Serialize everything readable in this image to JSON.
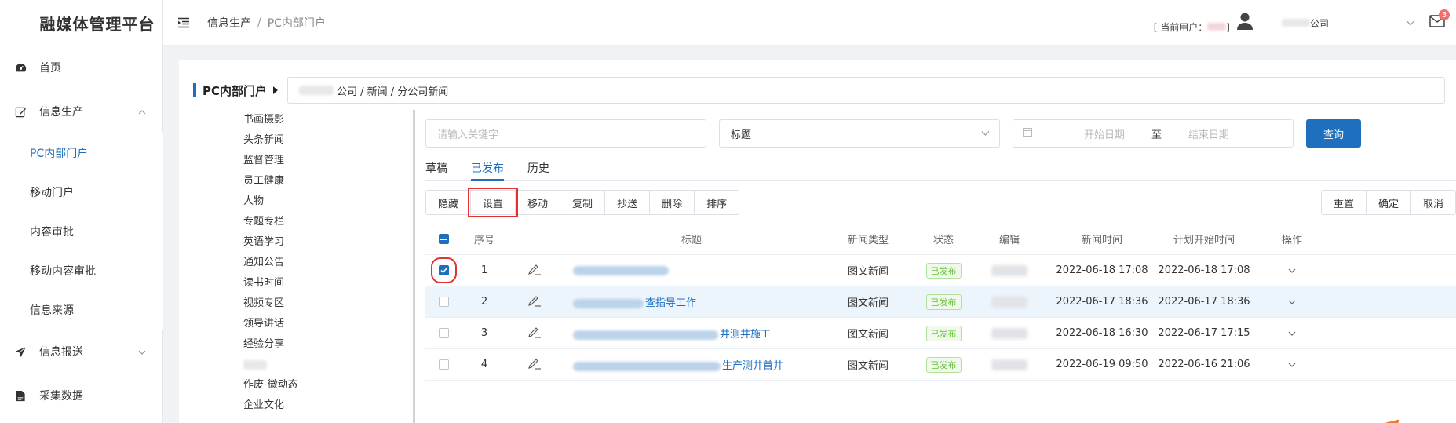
{
  "app": {
    "title": "融媒体管理平台"
  },
  "sidebar": {
    "items": [
      {
        "label": "首页",
        "icon": "dashboard-icon"
      },
      {
        "label": "信息生产",
        "icon": "edit-icon",
        "expanded": true,
        "children": [
          "PC内部门户",
          "移动门户",
          "内容审批",
          "移动内容审批",
          "信息来源"
        ]
      },
      {
        "label": "信息报送",
        "icon": "send-icon",
        "expanded": false
      },
      {
        "label": "采集数据",
        "icon": "document-icon"
      }
    ],
    "active_child": "PC内部门户"
  },
  "header": {
    "breadcrumb": [
      "信息生产",
      "PC内部门户"
    ],
    "breadcrumb_sep": "/",
    "current_user_label": "[ 当前用户：",
    "current_user_close": "]",
    "company_suffix": "公司",
    "notification_count": "3"
  },
  "panel": {
    "title": "PC内部门户",
    "path": "公司 / 新闻 / 分公司新闻"
  },
  "categories": [
    "书画摄影",
    "头条新闻",
    "监督管理",
    "员工健康",
    "人物",
    "专题专栏",
    "英语学习",
    "通知公告",
    "读书时间",
    "视频专区",
    "领导讲话",
    "经验分享",
    "",
    "作废-微动态",
    "企业文化"
  ],
  "filters": {
    "keyword_placeholder": "请输入关键字",
    "field_select": "标题",
    "start_date_placeholder": "开始日期",
    "date_to": "至",
    "end_date_placeholder": "结束日期",
    "query_label": "查询"
  },
  "tabs": [
    {
      "label": "草稿",
      "active": false
    },
    {
      "label": "已发布",
      "active": true
    },
    {
      "label": "历史",
      "active": false
    }
  ],
  "toolbar": {
    "left": [
      "隐藏",
      "设置",
      "移动",
      "复制",
      "抄送",
      "删除",
      "排序"
    ],
    "highlighted": "设置",
    "right": [
      "重置",
      "确定",
      "取消"
    ]
  },
  "table": {
    "headers": {
      "no": "序号",
      "title": "标题",
      "type": "新闻类型",
      "status": "状态",
      "editor": "编辑",
      "news_time": "新闻时间",
      "plan_time": "计划开始时间",
      "op": "操作"
    },
    "rows": [
      {
        "no": "1",
        "title": "",
        "type": "图文新闻",
        "status": "已发布",
        "news_time": "2022-06-18 17:08",
        "plan_time": "2022-06-18 17:08",
        "checked": true
      },
      {
        "no": "2",
        "title": "查指导工作",
        "type": "图文新闻",
        "status": "已发布",
        "news_time": "2022-06-17 18:36",
        "plan_time": "2022-06-17 18:36",
        "checked": false
      },
      {
        "no": "3",
        "title": "井测井施工",
        "type": "图文新闻",
        "status": "已发布",
        "news_time": "2022-06-18 16:30",
        "plan_time": "2022-06-17 17:15",
        "checked": false
      },
      {
        "no": "4",
        "title": "生产测井首井",
        "type": "图文新闻",
        "status": "已发布",
        "news_time": "2022-06-19 09:50",
        "plan_time": "2022-06-16 21:06",
        "checked": false
      }
    ]
  },
  "colors": {
    "accent": "#1f6fbf",
    "highlight_box": "#e23131",
    "status_green": "#67c23a"
  }
}
